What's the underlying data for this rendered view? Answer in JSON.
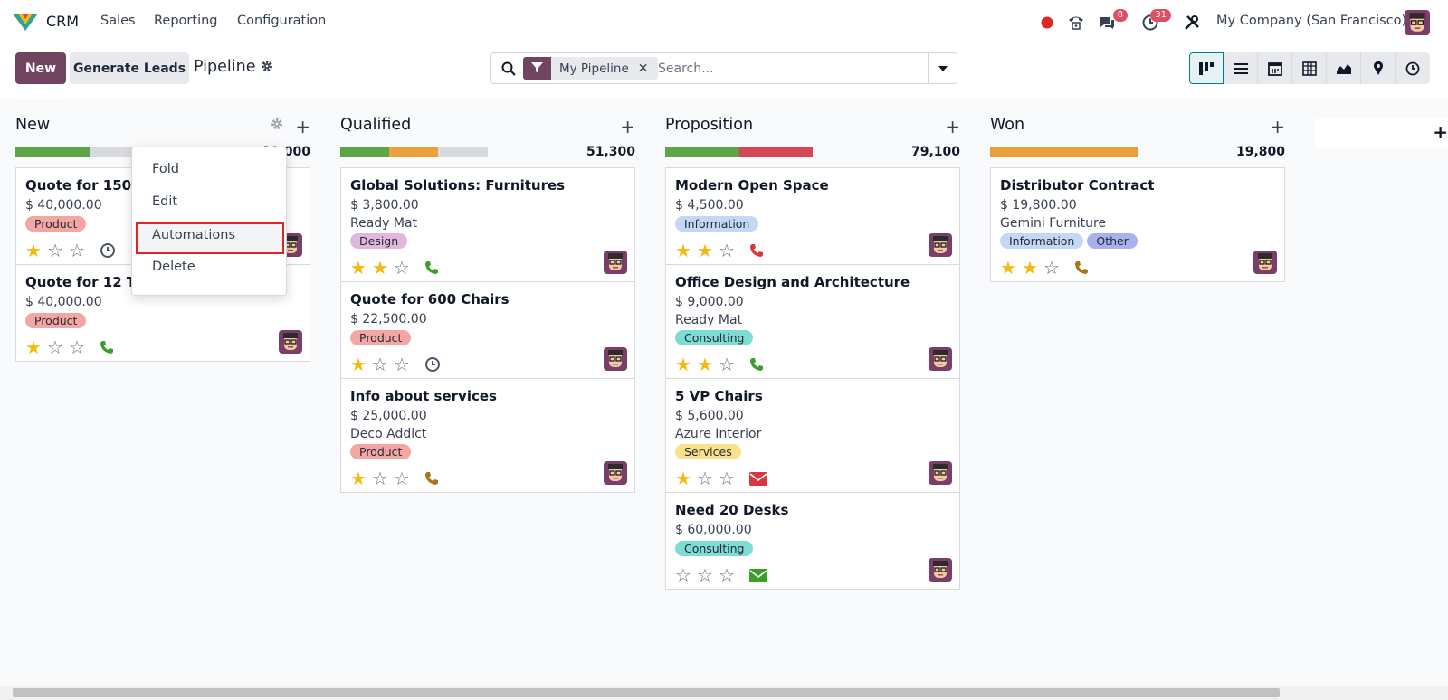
{
  "topbar": {
    "app_name": "CRM",
    "menu": [
      "Sales",
      "Reporting",
      "Configuration"
    ],
    "messages_badge": "8",
    "activities_badge": "31",
    "company": "My Company (San Francisco)"
  },
  "control": {
    "new_label": "New",
    "generate_label": "Generate Leads",
    "title": "Pipeline",
    "facet": "My Pipeline",
    "search_placeholder": "Search..."
  },
  "dropdown": {
    "items": [
      "Fold",
      "Edit",
      "Automations",
      "Delete"
    ]
  },
  "columns": [
    {
      "title": "New",
      "total": "80,000",
      "progress": [
        {
          "color": "#5ca445",
          "pct": 0.5
        },
        {
          "color": "#d9dadd",
          "pct": 0.5
        }
      ],
      "cards": [
        {
          "name": "Quote for 150 c",
          "revenue": "$ 40,000.00",
          "partner": "",
          "tags": [
            {
              "label": "Product",
              "color": "#f4a6a3"
            }
          ],
          "stars": 1,
          "activity": "clock"
        },
        {
          "name": "Quote for 12 Tables",
          "revenue": "$ 40,000.00",
          "partner": "",
          "tags": [
            {
              "label": "Product",
              "color": "#f4a6a3"
            }
          ],
          "stars": 1,
          "activity": "phone-green"
        }
      ]
    },
    {
      "title": "Qualified",
      "total": "51,300",
      "progress": [
        {
          "color": "#5ca445",
          "pct": 0.33
        },
        {
          "color": "#eaa03b",
          "pct": 0.33
        },
        {
          "color": "#d9dadd",
          "pct": 0.34
        }
      ],
      "cards": [
        {
          "name": "Global Solutions: Furnitures",
          "revenue": "$ 3,800.00",
          "partner": "Ready Mat",
          "tags": [
            {
              "label": "Design",
              "color": "#e3b7dc"
            }
          ],
          "stars": 2,
          "activity": "phone-green"
        },
        {
          "name": "Quote for 600 Chairs",
          "revenue": "$ 22,500.00",
          "partner": "",
          "tags": [
            {
              "label": "Product",
              "color": "#f4a6a3"
            }
          ],
          "stars": 1,
          "activity": "clock"
        },
        {
          "name": "Info about services",
          "revenue": "$ 25,000.00",
          "partner": "Deco Addict",
          "tags": [
            {
              "label": "Product",
              "color": "#f4a6a3"
            }
          ],
          "stars": 1,
          "activity": "phone-orange"
        }
      ]
    },
    {
      "title": "Proposition",
      "total": "79,100",
      "progress": [
        {
          "color": "#5ca445",
          "pct": 0.5
        },
        {
          "color": "#d74753",
          "pct": 0.5
        }
      ],
      "cards": [
        {
          "name": "Modern Open Space",
          "revenue": "$ 4,500.00",
          "partner": "",
          "tags": [
            {
              "label": "Information",
              "color": "#c3d8f5"
            }
          ],
          "stars": 2,
          "activity": "phone-red"
        },
        {
          "name": "Office Design and Architecture",
          "revenue": "$ 9,000.00",
          "partner": "Ready Mat",
          "tags": [
            {
              "label": "Consulting",
              "color": "#7fdcd3"
            }
          ],
          "stars": 2,
          "activity": "phone-green"
        },
        {
          "name": "5 VP Chairs",
          "revenue": "$ 5,600.00",
          "partner": "Azure Interior",
          "tags": [
            {
              "label": "Services",
              "color": "#fbe28a"
            }
          ],
          "stars": 1,
          "activity": "mail-red"
        },
        {
          "name": "Need 20 Desks",
          "revenue": "$ 60,000.00",
          "partner": "",
          "tags": [
            {
              "label": "Consulting",
              "color": "#7fdcd3"
            }
          ],
          "stars": 0,
          "activity": "mail-green"
        }
      ]
    },
    {
      "title": "Won",
      "total": "19,800",
      "progress": [
        {
          "color": "#eaa03b",
          "pct": 1.0
        }
      ],
      "cards": [
        {
          "name": "Distributor Contract",
          "revenue": "$ 19,800.00",
          "partner": "Gemini Furniture",
          "tags": [
            {
              "label": "Information",
              "color": "#c3d8f5"
            },
            {
              "label": "Other",
              "color": "#a9b0ee"
            }
          ],
          "stars": 2,
          "activity": "phone-orange"
        }
      ]
    }
  ],
  "colors": {
    "brand": "#71445f",
    "accent": "#017e84"
  }
}
